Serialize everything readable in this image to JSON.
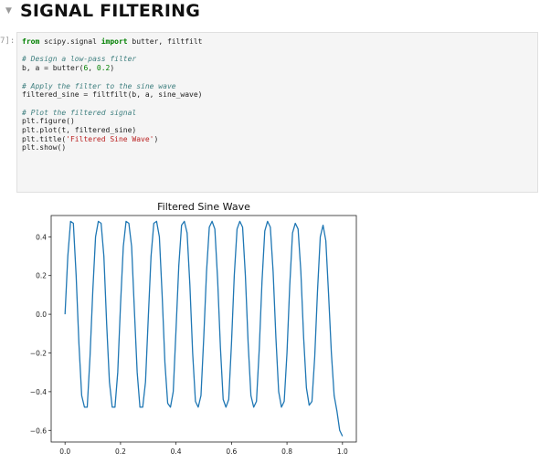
{
  "section": {
    "title": "SIGNAL FILTERING",
    "caret_icon": "chevron-down-icon"
  },
  "cell": {
    "prompt": "7]:",
    "code_lines": [
      [
        {
          "t": "from",
          "c": "kw"
        },
        {
          "t": " scipy.signal ",
          "c": ""
        },
        {
          "t": "import",
          "c": "kw"
        },
        {
          "t": " butter, filtfilt",
          "c": ""
        }
      ],
      [],
      [
        {
          "t": "# Design a low-pass filter",
          "c": "cm"
        }
      ],
      [
        {
          "t": "b, a ",
          "c": ""
        },
        {
          "t": "=",
          "c": ""
        },
        {
          "t": " butter(",
          "c": ""
        },
        {
          "t": "6",
          "c": "num"
        },
        {
          "t": ", ",
          "c": ""
        },
        {
          "t": "0.2",
          "c": "num"
        },
        {
          "t": ")",
          "c": ""
        }
      ],
      [],
      [
        {
          "t": "# Apply the filter to the sine wave",
          "c": "cm"
        }
      ],
      [
        {
          "t": "filtered_sine = filtfilt(b, a, sine_wave)",
          "c": ""
        }
      ],
      [],
      [
        {
          "t": "# Plot the filtered signal",
          "c": "cm"
        }
      ],
      [
        {
          "t": "plt.figure()",
          "c": ""
        }
      ],
      [
        {
          "t": "plt.plot(t, filtered_sine)",
          "c": ""
        }
      ],
      [
        {
          "t": "plt.title(",
          "c": ""
        },
        {
          "t": "'Filtered Sine Wave'",
          "c": "str"
        },
        {
          "t": ")",
          "c": ""
        }
      ],
      [
        {
          "t": "plt.show()",
          "c": ""
        }
      ]
    ]
  },
  "chart_data": {
    "type": "line",
    "title": "Filtered Sine Wave",
    "xlabel": "",
    "ylabel": "",
    "xlim": [
      -0.05,
      1.05
    ],
    "ylim": [
      -0.66,
      0.51
    ],
    "xticks": [
      "0.0",
      "0.2",
      "0.4",
      "0.6",
      "0.8",
      "1.0"
    ],
    "xtick_values": [
      0.0,
      0.2,
      0.4,
      0.6,
      0.8,
      1.0
    ],
    "yticks": [
      "0.4",
      "0.2",
      "0.0",
      "−0.2",
      "−0.4",
      "−0.6"
    ],
    "ytick_values": [
      0.4,
      0.2,
      0.0,
      -0.2,
      -0.4,
      -0.6
    ],
    "line_color": "#1f77b4",
    "series": [
      {
        "x": [
          0.0,
          0.01,
          0.02,
          0.03,
          0.04,
          0.05,
          0.06,
          0.07,
          0.08,
          0.09,
          0.1,
          0.11,
          0.12,
          0.13,
          0.14,
          0.15,
          0.16,
          0.17,
          0.18,
          0.19,
          0.2,
          0.21,
          0.22,
          0.23,
          0.24,
          0.25,
          0.26,
          0.27,
          0.28,
          0.29,
          0.3,
          0.31,
          0.32,
          0.33,
          0.34,
          0.35,
          0.36,
          0.37,
          0.38,
          0.39,
          0.4,
          0.41,
          0.42,
          0.43,
          0.44,
          0.45,
          0.46,
          0.47,
          0.48,
          0.49,
          0.5,
          0.51,
          0.52,
          0.53,
          0.54,
          0.55,
          0.56,
          0.57,
          0.58,
          0.59,
          0.6,
          0.61,
          0.62,
          0.63,
          0.64,
          0.65,
          0.66,
          0.67,
          0.68,
          0.69,
          0.7,
          0.71,
          0.72,
          0.73,
          0.74,
          0.75,
          0.76,
          0.77,
          0.78,
          0.79,
          0.8,
          0.81,
          0.82,
          0.83,
          0.84,
          0.85,
          0.86,
          0.87,
          0.88,
          0.89,
          0.9,
          0.91,
          0.92,
          0.93,
          0.94,
          0.95,
          0.96,
          0.97,
          0.98,
          0.99,
          1.0
        ],
        "y": [
          0.0,
          0.3,
          0.48,
          0.47,
          0.2,
          -0.15,
          -0.42,
          -0.48,
          -0.48,
          -0.22,
          0.12,
          0.4,
          0.48,
          0.47,
          0.3,
          -0.05,
          -0.35,
          -0.48,
          -0.48,
          -0.3,
          0.05,
          0.35,
          0.48,
          0.47,
          0.35,
          0.02,
          -0.3,
          -0.48,
          -0.48,
          -0.35,
          -0.02,
          0.3,
          0.47,
          0.48,
          0.4,
          0.1,
          -0.25,
          -0.46,
          -0.48,
          -0.4,
          -0.08,
          0.25,
          0.46,
          0.48,
          0.42,
          0.15,
          -0.2,
          -0.45,
          -0.48,
          -0.42,
          -0.12,
          0.22,
          0.45,
          0.48,
          0.44,
          0.18,
          -0.17,
          -0.44,
          -0.48,
          -0.44,
          -0.15,
          0.2,
          0.44,
          0.48,
          0.45,
          0.2,
          -0.15,
          -0.42,
          -0.48,
          -0.45,
          -0.18,
          0.17,
          0.43,
          0.48,
          0.45,
          0.22,
          -0.12,
          -0.4,
          -0.48,
          -0.45,
          -0.2,
          0.15,
          0.42,
          0.47,
          0.44,
          0.22,
          -0.12,
          -0.38,
          -0.47,
          -0.45,
          -0.22,
          0.12,
          0.4,
          0.46,
          0.38,
          0.1,
          -0.2,
          -0.42,
          -0.5,
          -0.6,
          -0.63
        ]
      }
    ]
  }
}
